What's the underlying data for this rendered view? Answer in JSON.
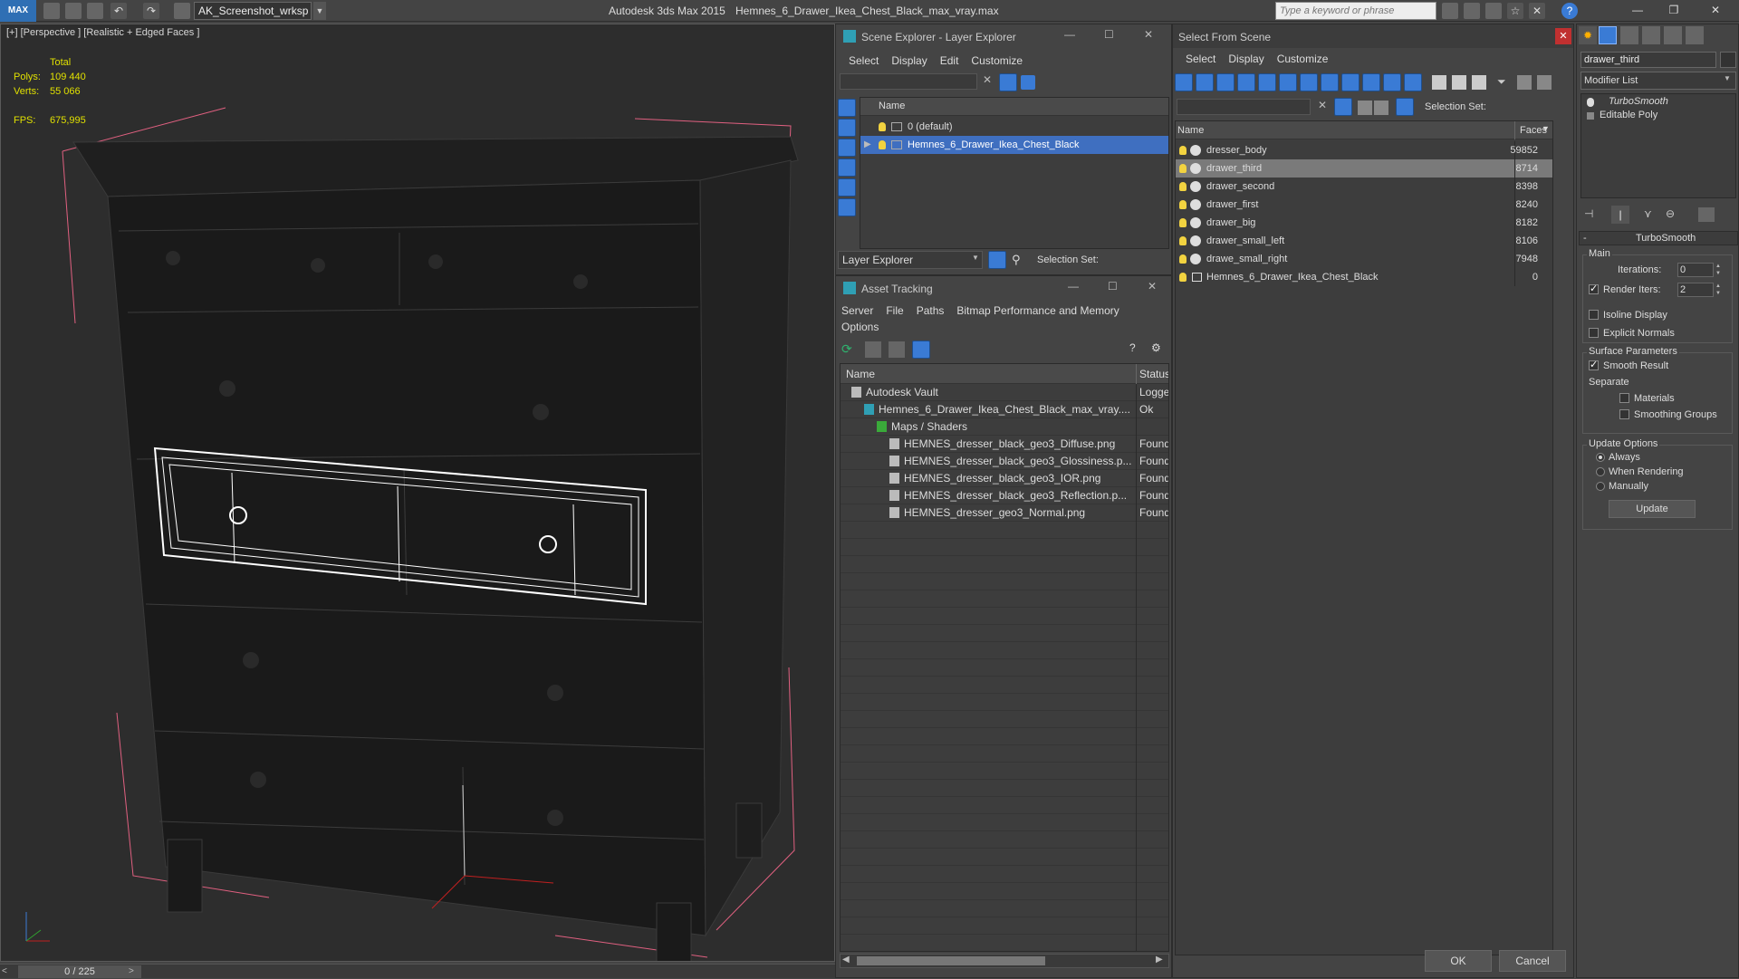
{
  "app": {
    "title": "Autodesk 3ds Max  2015",
    "file": "Hemnes_6_Drawer_Ikea_Chest_Black_max_vray.max",
    "workspace": "AK_Screenshot_wrksp",
    "search_placeholder": "Type a keyword or phrase"
  },
  "viewport": {
    "label": "[+] [Perspective ] [Realistic + Edged Faces ]",
    "stats_total": "Total",
    "polys_label": "Polys:",
    "polys_value": "109 440",
    "verts_label": "Verts:",
    "verts_value": "55 066",
    "fps_label": "FPS:",
    "fps_value": "675,995",
    "timeline": "0 / 225"
  },
  "scene_explorer": {
    "title": "Scene Explorer - Layer Explorer",
    "menu": [
      "Select",
      "Display",
      "Edit",
      "Customize"
    ],
    "header_name": "Name",
    "layers": [
      "0 (default)",
      "Hemnes_6_Drawer_Ikea_Chest_Black"
    ],
    "footer_dropdown": "Layer Explorer",
    "selection_set": "Selection Set:"
  },
  "asset_tracking": {
    "title": "Asset Tracking",
    "menu": [
      "Server",
      "File",
      "Paths",
      "Bitmap Performance and Memory"
    ],
    "menu2": "Options",
    "col_name": "Name",
    "col_status": "Status",
    "rows": [
      {
        "name": "Autodesk Vault",
        "status": "Logge",
        "indent": 0
      },
      {
        "name": "Hemnes_6_Drawer_Ikea_Chest_Black_max_vray....",
        "status": "Ok",
        "indent": 1
      },
      {
        "name": "Maps / Shaders",
        "status": "",
        "indent": 2
      },
      {
        "name": "HEMNES_dresser_black_geo3_Diffuse.png",
        "status": "Found",
        "indent": 3
      },
      {
        "name": "HEMNES_dresser_black_geo3_Glossiness.p...",
        "status": "Found",
        "indent": 3
      },
      {
        "name": "HEMNES_dresser_black_geo3_IOR.png",
        "status": "Found",
        "indent": 3
      },
      {
        "name": "HEMNES_dresser_black_geo3_Reflection.p...",
        "status": "Found",
        "indent": 3
      },
      {
        "name": "HEMNES_dresser_geo3_Normal.png",
        "status": "Found",
        "indent": 3
      }
    ]
  },
  "select_from_scene": {
    "title": "Select From Scene",
    "menu": [
      "Select",
      "Display",
      "Customize"
    ],
    "selection_set": "Selection Set:",
    "col_name": "Name",
    "col_faces": "Faces",
    "objects": [
      {
        "name": "dresser_body",
        "faces": "59852"
      },
      {
        "name": "drawer_third",
        "faces": "8714"
      },
      {
        "name": "drawer_second",
        "faces": "8398"
      },
      {
        "name": "drawer_first",
        "faces": "8240"
      },
      {
        "name": "drawer_big",
        "faces": "8182"
      },
      {
        "name": "drawer_small_left",
        "faces": "8106"
      },
      {
        "name": "drawe_small_right",
        "faces": "7948"
      },
      {
        "name": "Hemnes_6_Drawer_Ikea_Chest_Black",
        "faces": "0"
      }
    ],
    "ok": "OK",
    "cancel": "Cancel"
  },
  "command_panel": {
    "object_name": "drawer_third",
    "modifier_list": "Modifier List",
    "stack": [
      "TurboSmooth",
      "Editable Poly"
    ],
    "rollout_title": "TurboSmooth",
    "main_label": "Main",
    "iterations_label": "Iterations:",
    "iterations_value": "0",
    "render_iters_label": "Render Iters:",
    "render_iters_value": "2",
    "isoline": "Isoline Display",
    "explicit_normals": "Explicit Normals",
    "surface_params": "Surface Parameters",
    "smooth_result": "Smooth Result",
    "separate": "Separate",
    "materials": "Materials",
    "smoothing_groups": "Smoothing Groups",
    "update_options": "Update Options",
    "always": "Always",
    "when_rendering": "When Rendering",
    "manually": "Manually",
    "update": "Update"
  }
}
